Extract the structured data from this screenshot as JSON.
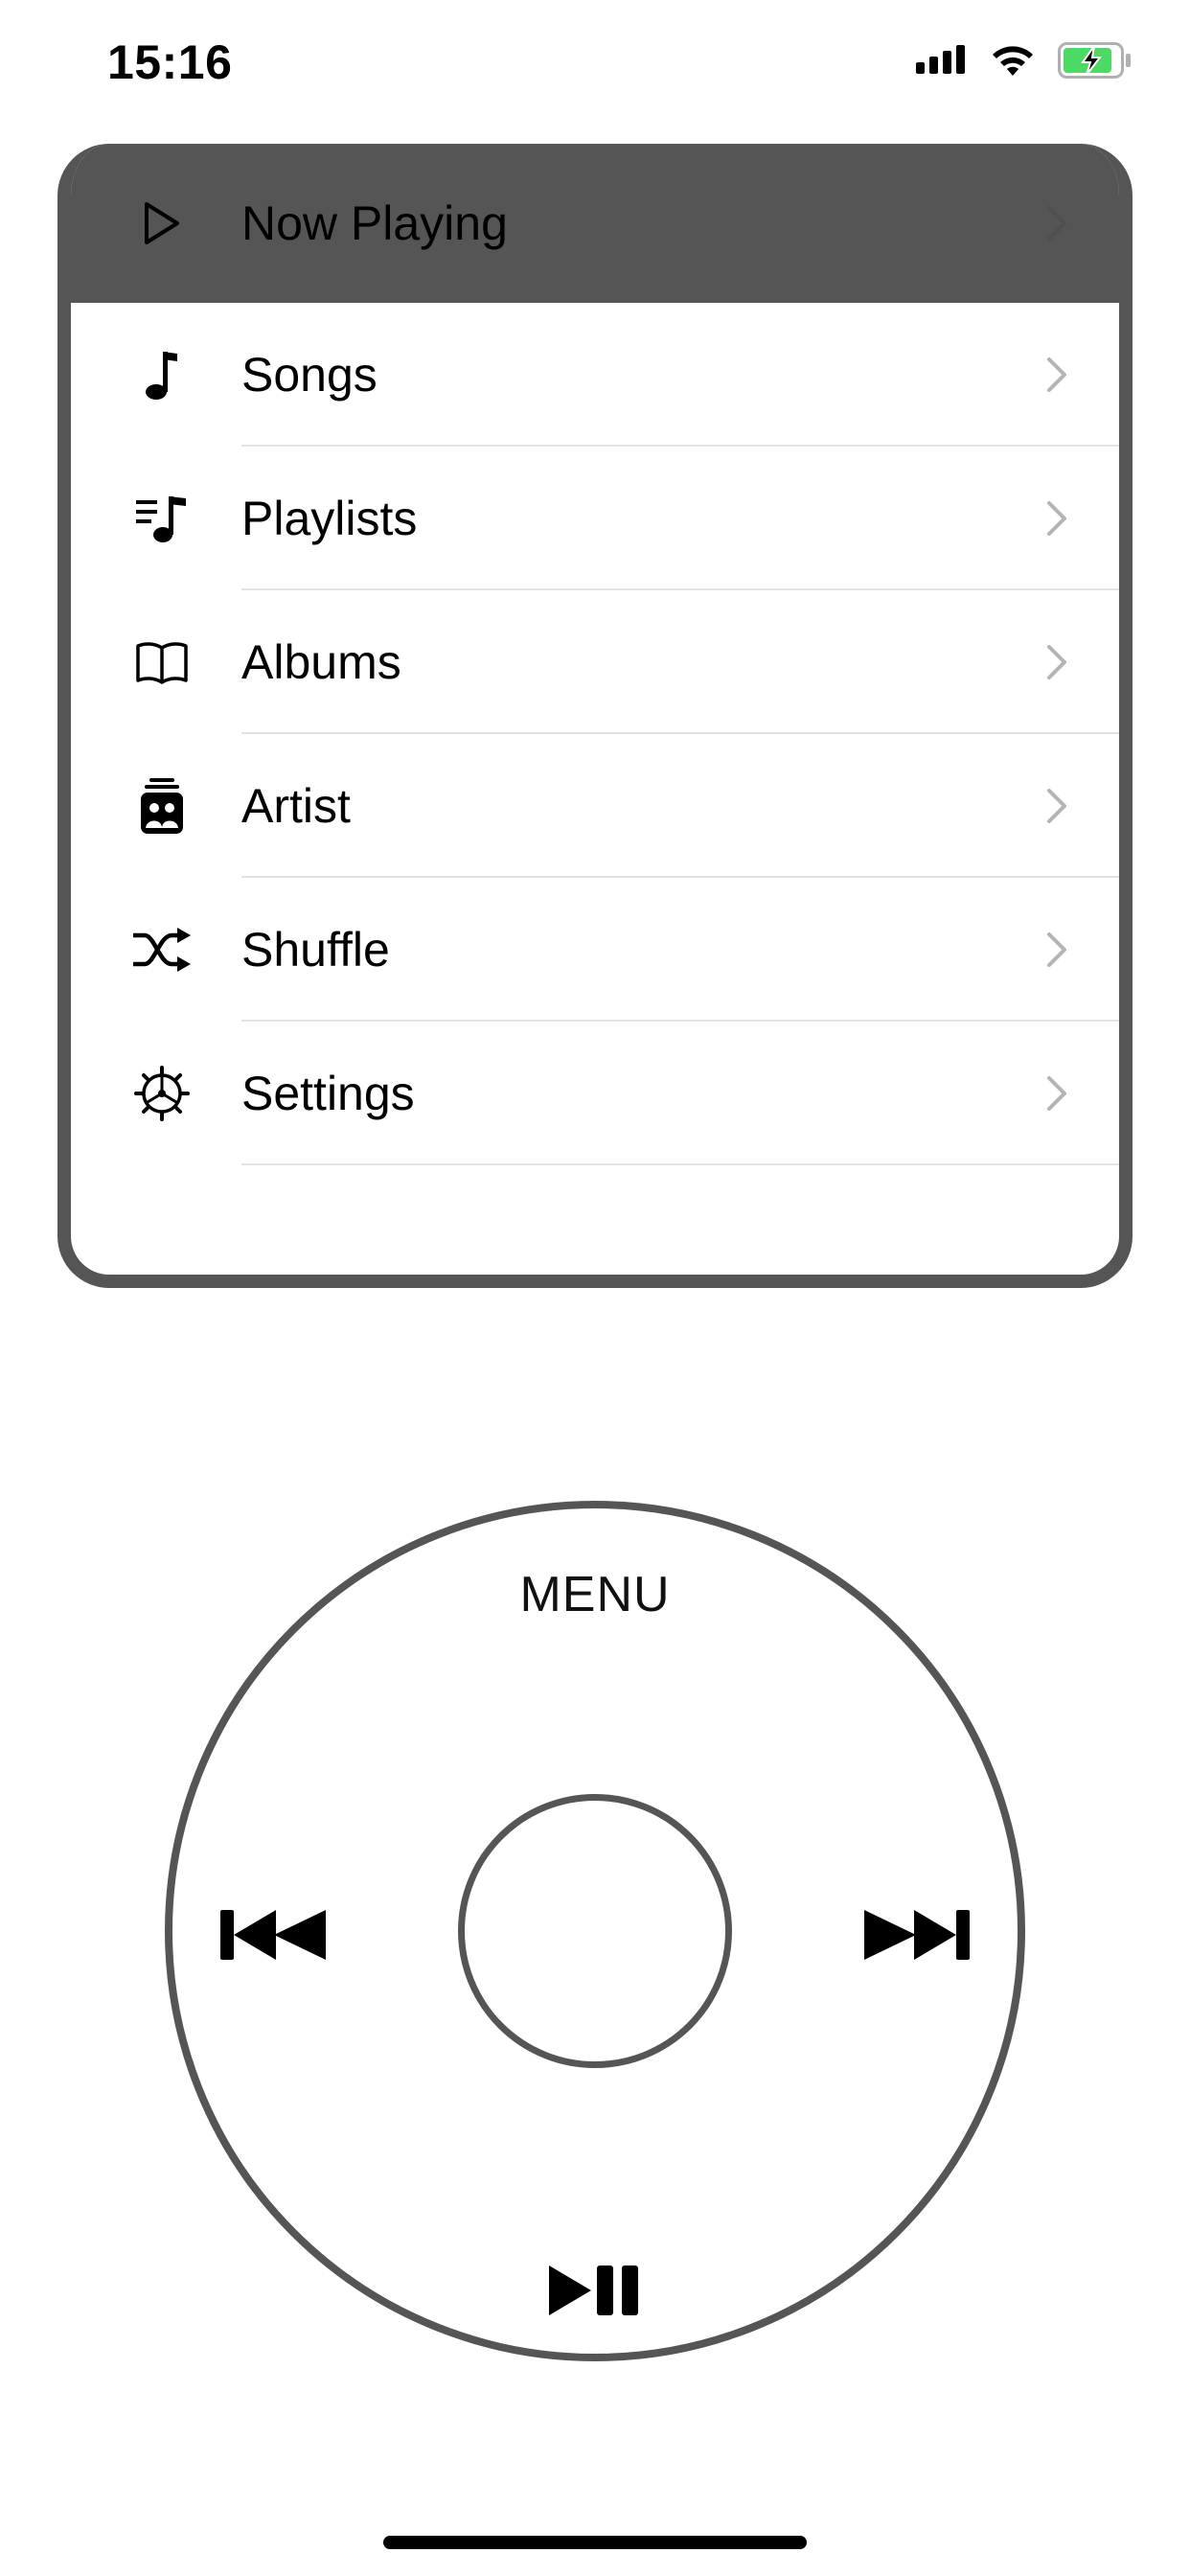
{
  "status_bar": {
    "time": "15:16",
    "icons": [
      "cellular-signal-icon",
      "wifi-icon",
      "battery-charging-icon"
    ],
    "battery_color": "#4cd964"
  },
  "menu": {
    "now_playing_label": "Now Playing",
    "items": [
      {
        "label": "Songs",
        "icon": "music-note-icon"
      },
      {
        "label": "Playlists",
        "icon": "playlist-icon"
      },
      {
        "label": "Albums",
        "icon": "book-icon"
      },
      {
        "label": "Artist",
        "icon": "artist-icon"
      },
      {
        "label": "Shuffle",
        "icon": "shuffle-icon"
      },
      {
        "label": "Settings",
        "icon": "gear-icon"
      }
    ]
  },
  "wheel": {
    "menu_label": "MENU",
    "controls": [
      "previous-icon",
      "next-icon",
      "play-pause-icon"
    ]
  },
  "colors": {
    "frame": "#555555",
    "divider": "#e3e3e3",
    "chevron": "#b4b4b4"
  }
}
